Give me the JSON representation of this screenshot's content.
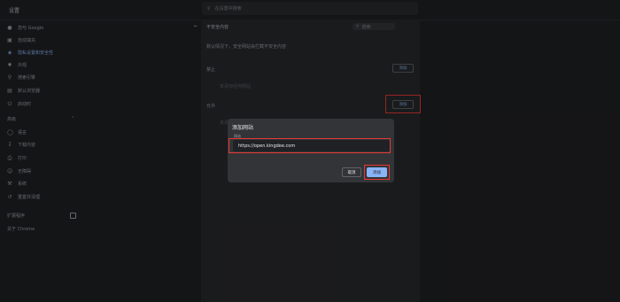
{
  "app": {
    "title": "设置"
  },
  "search": {
    "placeholder": "在设置中搜索"
  },
  "sidebar": {
    "items": [
      {
        "label": "您与 Google",
        "icon": "person-icon"
      },
      {
        "label": "自动填充",
        "icon": "autofill-icon"
      },
      {
        "label": "隐私设置和安全性",
        "icon": "shield-icon",
        "active": true
      },
      {
        "label": "外观",
        "icon": "palette-icon"
      },
      {
        "label": "搜索引擎",
        "icon": "search-icon"
      },
      {
        "label": "默认浏览器",
        "icon": "browser-icon"
      },
      {
        "label": "启动时",
        "icon": "power-icon"
      }
    ],
    "advanced_label": "高级",
    "advanced_items": [
      {
        "label": "语言",
        "icon": "globe-icon"
      },
      {
        "label": "下载内容",
        "icon": "download-icon"
      },
      {
        "label": "打印",
        "icon": "print-icon"
      },
      {
        "label": "无障碍",
        "icon": "accessibility-icon"
      },
      {
        "label": "系统",
        "icon": "wrench-icon"
      },
      {
        "label": "重置并清理",
        "icon": "reset-icon"
      }
    ],
    "extensions_label": "扩展程序",
    "about_label": "关于 Chrome"
  },
  "content": {
    "title": "不安全内容",
    "search_placeholder": "搜索",
    "description": "默认情况下，安全网站会拦截不安全内容",
    "block_label": "禁止",
    "block_empty": "未添加任何网站",
    "allow_label": "允许",
    "allow_empty": "未添加任何网站",
    "add_label": "添加"
  },
  "dialog": {
    "title": "添加网站",
    "field_label": "网站",
    "field_value": "https://open.kingdee.com",
    "cancel_label": "取消",
    "add_label": "添加"
  },
  "colors": {
    "accent": "#8ab4f8",
    "highlight": "#e53935",
    "background": "#202124"
  }
}
